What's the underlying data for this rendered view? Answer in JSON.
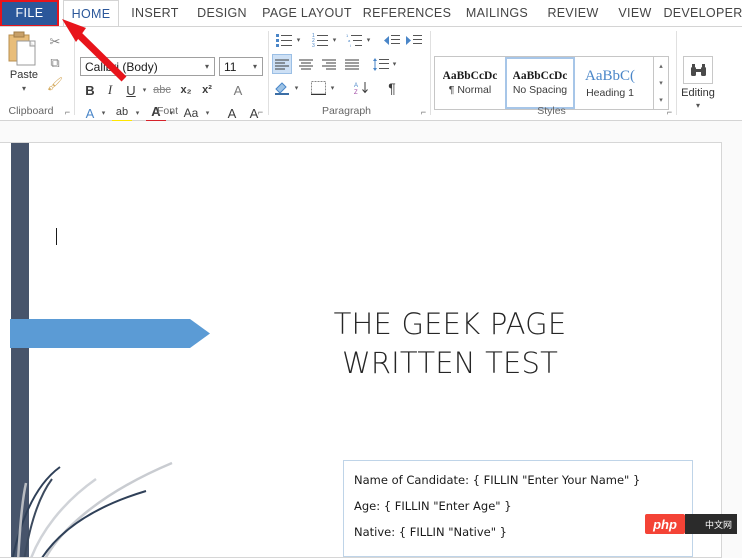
{
  "app": {
    "name": "Microsoft Word",
    "accent_blue": "#2b579a",
    "annotation_red": "#e8141b"
  },
  "ribbon": {
    "file_tab": {
      "label": "FILE",
      "highlighted": true,
      "highlight_color": "#e8141b"
    },
    "tabs": [
      {
        "label": "HOME",
        "active": true
      },
      {
        "label": "INSERT",
        "active": false
      },
      {
        "label": "DESIGN",
        "active": false
      },
      {
        "label": "PAGE LAYOUT",
        "active": false
      },
      {
        "label": "REFERENCES",
        "active": false
      },
      {
        "label": "MAILINGS",
        "active": false
      },
      {
        "label": "REVIEW",
        "active": false
      },
      {
        "label": "VIEW",
        "active": false
      },
      {
        "label": "DEVELOPER",
        "active": false
      }
    ],
    "groups": {
      "clipboard": {
        "label": "Clipboard",
        "paste_label": "Paste",
        "paste_caret": "▾",
        "dialog_launcher": "⌐",
        "items": [
          {
            "name": "cut-icon",
            "glyph": "✂"
          },
          {
            "name": "copy-icon",
            "glyph": "⧉"
          },
          {
            "name": "format-painter-icon",
            "glyph": "🖌"
          }
        ]
      },
      "font": {
        "label": "Font",
        "dialog_launcher": "⌐",
        "font_name": "Calibri (Body)",
        "font_size": "11",
        "font_name_caret": "▾",
        "font_size_caret": "▾",
        "buttons": [
          {
            "name": "bold-button",
            "glyph": "B"
          },
          {
            "name": "italic-button",
            "glyph": "I"
          },
          {
            "name": "underline-button",
            "glyph": "U"
          },
          {
            "name": "underline-caret",
            "glyph": "▾"
          },
          {
            "name": "strikethrough-button",
            "glyph": "abc"
          },
          {
            "name": "subscript-button",
            "glyph": "x₂"
          },
          {
            "name": "superscript-button",
            "glyph": "x²"
          },
          {
            "name": "clear-formatting-button",
            "glyph": "A"
          },
          {
            "name": "text-effects-button",
            "glyph": "A"
          },
          {
            "name": "text-highlight-button",
            "glyph": "ab"
          },
          {
            "name": "font-color-button",
            "glyph": "A"
          },
          {
            "name": "change-case-button",
            "glyph": "Aa"
          },
          {
            "name": "grow-font-button",
            "glyph": "A"
          },
          {
            "name": "shrink-font-button",
            "glyph": "A"
          }
        ]
      },
      "paragraph": {
        "label": "Paragraph",
        "dialog_launcher": "⌐",
        "buttons": [
          {
            "name": "bullets-button",
            "glyph": "≔"
          },
          {
            "name": "numbering-button",
            "glyph": "≕"
          },
          {
            "name": "multilevel-list-button",
            "glyph": "≖"
          },
          {
            "name": "decrease-indent-button",
            "glyph": "⇤"
          },
          {
            "name": "increase-indent-button",
            "glyph": "⇥"
          },
          {
            "name": "align-left-button",
            "glyph": "≡",
            "selected": true
          },
          {
            "name": "align-center-button",
            "glyph": "≡"
          },
          {
            "name": "align-right-button",
            "glyph": "≡"
          },
          {
            "name": "justify-button",
            "glyph": "≡"
          },
          {
            "name": "line-spacing-button",
            "glyph": "↕"
          },
          {
            "name": "shading-button",
            "glyph": "◢"
          },
          {
            "name": "borders-button",
            "glyph": "⊞"
          },
          {
            "name": "sort-button",
            "glyph": "A↓"
          },
          {
            "name": "show-formatting-marks-button",
            "glyph": "¶"
          }
        ]
      },
      "styles": {
        "label": "Styles",
        "dialog_launcher": "⌐",
        "items": [
          {
            "preview": "AaBbCcDc",
            "name": "¶ Normal",
            "selected": false
          },
          {
            "preview": "AaBbCcDc",
            "name": "No Spacing",
            "selected": true
          },
          {
            "preview": "AaBbC(",
            "name": "Heading 1",
            "selected": false
          }
        ],
        "scroll_up": "▴",
        "scroll_down": "▾",
        "scroll_more": "▾"
      },
      "editing": {
        "label": "Editing",
        "icon": "find-binoculars-icon",
        "glyph": "🔍",
        "caret": "▾"
      }
    }
  },
  "document": {
    "title_lines": [
      "THE GEEK PAGE",
      "WRITTEN TEST"
    ],
    "textbox_lines": [
      "Name of Candidate: { FILLIN \"Enter Your Name\" }",
      "Age: { FILLIN \"Enter Age\" }",
      "Native: { FILLIN \"Native\" }"
    ],
    "decoration": {
      "sidebar_color": "#47546b",
      "arrow_color": "#5b9bd5",
      "grass_dark": "#3c4a5e",
      "grass_light": "#c9ccd1"
    },
    "cursor_visible": true
  },
  "watermark": {
    "php_label": "php",
    "dark_label": "中文网"
  }
}
